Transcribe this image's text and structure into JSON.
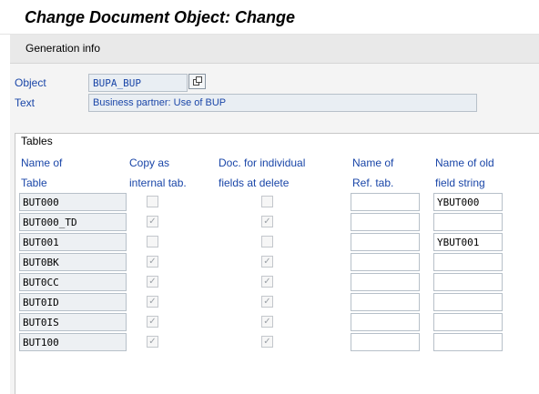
{
  "window": {
    "title": "Change Document Object: Change"
  },
  "toolbar": {
    "generation_info": "Generation info"
  },
  "header": {
    "object_label": "Object",
    "object_value": "BUPA_BUP",
    "text_label": "Text",
    "text_value": "Business partner: Use of BUP"
  },
  "tables": {
    "group_title": "Tables",
    "columns": {
      "name_line1": "Name of",
      "name_line2": "Table",
      "copy_line1": "Copy as",
      "copy_line2": "internal tab.",
      "doc_line1": "Doc. for individual",
      "doc_line2": "fields at delete",
      "ref_line1": "Name of",
      "ref_line2": "Ref. tab.",
      "old_line1": "Name of old",
      "old_line2": "field string"
    },
    "rows": [
      {
        "name": "BUT000",
        "copy_internal": false,
        "doc_delete": false,
        "ref_tab": "",
        "old_field": "YBUT000"
      },
      {
        "name": "BUT000_TD",
        "copy_internal": true,
        "doc_delete": true,
        "ref_tab": "",
        "old_field": ""
      },
      {
        "name": "BUT001",
        "copy_internal": false,
        "doc_delete": false,
        "ref_tab": "",
        "old_field": "YBUT001"
      },
      {
        "name": "BUT0BK",
        "copy_internal": true,
        "doc_delete": true,
        "ref_tab": "",
        "old_field": ""
      },
      {
        "name": "BUT0CC",
        "copy_internal": true,
        "doc_delete": true,
        "ref_tab": "",
        "old_field": ""
      },
      {
        "name": "BUT0ID",
        "copy_internal": true,
        "doc_delete": true,
        "ref_tab": "",
        "old_field": ""
      },
      {
        "name": "BUT0IS",
        "copy_internal": true,
        "doc_delete": true,
        "ref_tab": "",
        "old_field": ""
      },
      {
        "name": "BUT100",
        "copy_internal": true,
        "doc_delete": true,
        "ref_tab": "",
        "old_field": ""
      }
    ]
  },
  "colors": {
    "label_blue": "#1a46a8",
    "toolbar_gray": "#e9e9e9"
  }
}
